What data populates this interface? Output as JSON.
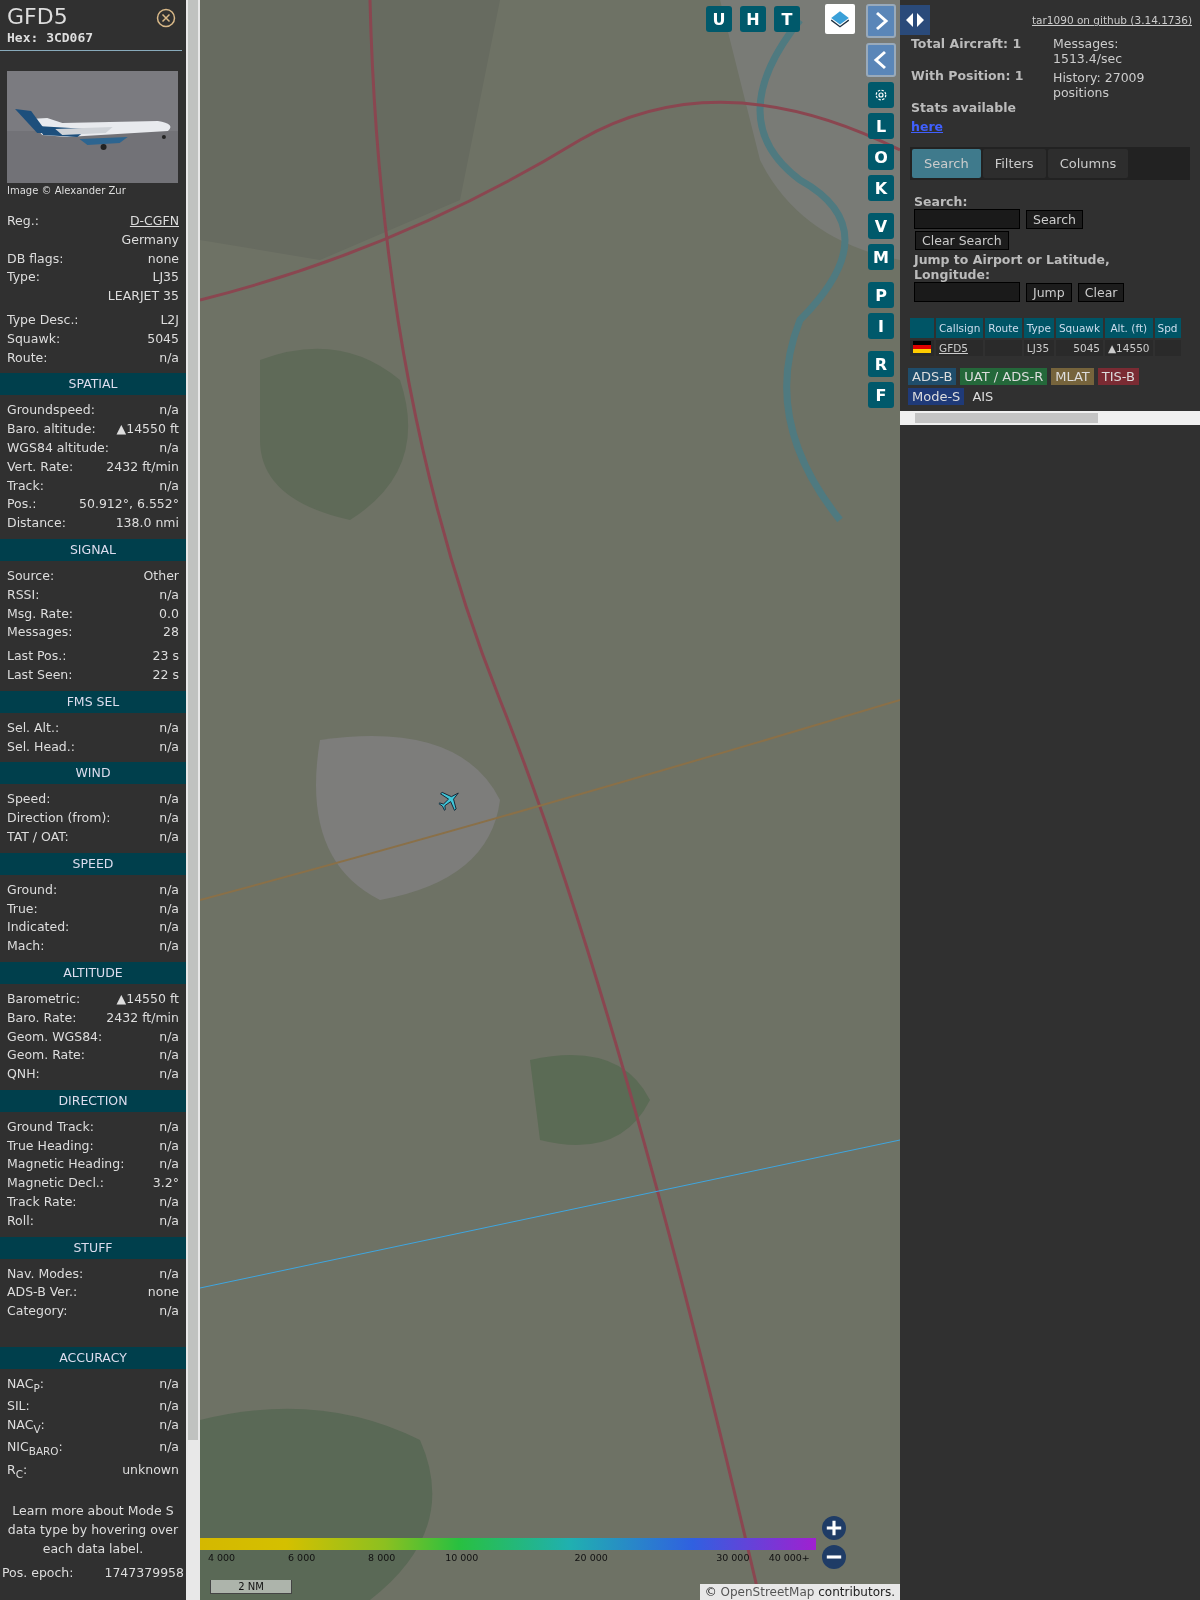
{
  "aircraft": {
    "callsign": "GFD5",
    "hex": "Hex: 3CD067",
    "photo": {
      "kind": "picture",
      "credit": "Image © Alexander Zur"
    }
  },
  "sections": [
    {
      "rows": [
        {
          "label": "Reg.:",
          "value": "D-CGFN",
          "link": true
        },
        {
          "value": "Germany"
        },
        {
          "label": "DB flags:",
          "value": "none"
        },
        {
          "label": "Type:",
          "value": "LJ35"
        },
        {
          "value": "LEARJET 35"
        },
        {
          "label": "Type Desc.:",
          "value": "L2J",
          "spaced": true
        },
        {
          "label": "Squawk:",
          "value": "5045"
        },
        {
          "label": "Route:",
          "value": "n/a"
        }
      ]
    },
    {
      "title": "SPATIAL",
      "rows": [
        {
          "label": "Groundspeed:",
          "value": "n/a"
        },
        {
          "label": "Baro. altitude:",
          "value": "▲14550 ft"
        },
        {
          "label": "WGS84 altitude:",
          "value": "n/a"
        },
        {
          "label": "Vert. Rate:",
          "value": "2432 ft/min"
        },
        {
          "label": "Track:",
          "value": "n/a"
        },
        {
          "label": "Pos.:",
          "value": "50.912°, 6.552°"
        },
        {
          "label": "Distance:",
          "value": "138.0 nmi"
        }
      ]
    },
    {
      "title": "SIGNAL",
      "rows": [
        {
          "label": "Source:",
          "value": "Other"
        },
        {
          "label": "RSSI:",
          "value": "n/a"
        },
        {
          "label": "Msg. Rate:",
          "value": "0.0"
        },
        {
          "label": "Messages:",
          "value": "28"
        },
        {
          "label": "Last Pos.:",
          "value": "23 s",
          "spaced": true
        },
        {
          "label": "Last Seen:",
          "value": "22 s"
        }
      ]
    },
    {
      "title": "FMS SEL",
      "rows": [
        {
          "label": "Sel. Alt.:",
          "value": "n/a"
        },
        {
          "label": "Sel. Head.:",
          "value": "n/a"
        }
      ]
    },
    {
      "title": "WIND",
      "rows": [
        {
          "label": "Speed:",
          "value": "n/a"
        },
        {
          "label": "Direction (from):",
          "value": "n/a"
        },
        {
          "label": "TAT / OAT:",
          "value": "n/a"
        }
      ]
    },
    {
      "title": "SPEED",
      "rows": [
        {
          "label": "Ground:",
          "value": "n/a"
        },
        {
          "label": "True:",
          "value": "n/a"
        },
        {
          "label": "Indicated:",
          "value": "n/a"
        },
        {
          "label": "Mach:",
          "value": "n/a"
        }
      ]
    },
    {
      "title": "ALTITUDE",
      "rows": [
        {
          "label": "Barometric:",
          "value": "▲14550 ft"
        },
        {
          "label": "Baro. Rate:",
          "value": "2432 ft/min"
        },
        {
          "label": "Geom. WGS84:",
          "value": "n/a"
        },
        {
          "label": "Geom. Rate:",
          "value": "n/a"
        },
        {
          "label": "QNH:",
          "value": "n/a"
        }
      ]
    },
    {
      "title": "DIRECTION",
      "rows": [
        {
          "label": "Ground Track:",
          "value": "n/a"
        },
        {
          "label": "True Heading:",
          "value": "n/a"
        },
        {
          "label": "Magnetic Heading:",
          "value": "n/a"
        },
        {
          "label": "Magnetic Decl.:",
          "value": "3.2°"
        },
        {
          "label": "Track Rate:",
          "value": "n/a"
        },
        {
          "label": "Roll:",
          "value": "n/a"
        }
      ]
    },
    {
      "title": "STUFF",
      "rows": [
        {
          "label": "Nav. Modes:",
          "value": "n/a"
        },
        {
          "label": "ADS-B Ver.:",
          "value": "none"
        },
        {
          "label": "Category:",
          "value": "n/a"
        }
      ]
    },
    {
      "title": "ACCURACY",
      "spaced": true,
      "rows": [
        {
          "label": "NAC$_{P}$:",
          "value": "n/a"
        },
        {
          "label": "SIL:",
          "value": "n/a"
        },
        {
          "label": "NAC$_{V}$:",
          "value": "n/a"
        },
        {
          "label": "NIC$_{BARO}$:",
          "value": "n/a"
        },
        {
          "label": "R$_{C}$:",
          "value": "unknown"
        }
      ]
    }
  ],
  "help_text": "Learn more about Mode S data type by hovering over each data label.",
  "epoch": {
    "label": "Pos. epoch:",
    "value": "1747379958"
  },
  "map": {
    "kind": "picture",
    "top_buttons": [
      "U",
      "H",
      "T"
    ],
    "side_buttons": [
      "L",
      "O",
      "K",
      "V",
      "M",
      "P",
      "I",
      "R",
      "F"
    ],
    "legend": [
      "4 000",
      "6 000",
      "8 000",
      "10 000",
      "20 000",
      "30 000",
      "40 000+"
    ],
    "scale": "2 NM",
    "attribution": {
      "prefix": "©",
      "link": "OpenStreetMap",
      "suffix": "contributors."
    }
  },
  "github": "tar1090 on github (3.14.1736)",
  "stats": {
    "total": "Total Aircraft: 1",
    "with_position": "With Position: 1",
    "stats_text": "Stats available",
    "stats_link": "here",
    "messages": "Messages: 1513.4/sec",
    "history": "History: 27009 positions"
  },
  "tabs": [
    {
      "label": "Search",
      "selected": true
    },
    {
      "label": "Filters",
      "selected": false
    },
    {
      "label": "Columns",
      "selected": false
    }
  ],
  "search": {
    "label": "Search:",
    "button": "Search",
    "clear": "Clear Search",
    "jump_label": "Jump to Airport or Latitude, Longitude:",
    "jump": "Jump",
    "jump_clear": "Clear"
  },
  "table": {
    "columns": [
      "Callsign",
      "Route",
      "Type",
      "Squawk",
      "Alt. (ft)",
      "Spd"
    ],
    "rows": [
      {
        "callsign": "GFD5",
        "type": "LJ35",
        "squawk": "5045",
        "altitude": "▲14550"
      }
    ]
  },
  "sources": [
    {
      "label": "ADS-B",
      "color": "#1f4d6b"
    },
    {
      "label": "UAT / ADS-R",
      "color": "#24683a"
    },
    {
      "label": "MLAT",
      "color": "#76643c"
    },
    {
      "label": "TIS-B",
      "color": "#7a2b33"
    },
    {
      "label": "Mode-S",
      "color": "#1f3a78"
    },
    {
      "label": "AIS"
    }
  ]
}
